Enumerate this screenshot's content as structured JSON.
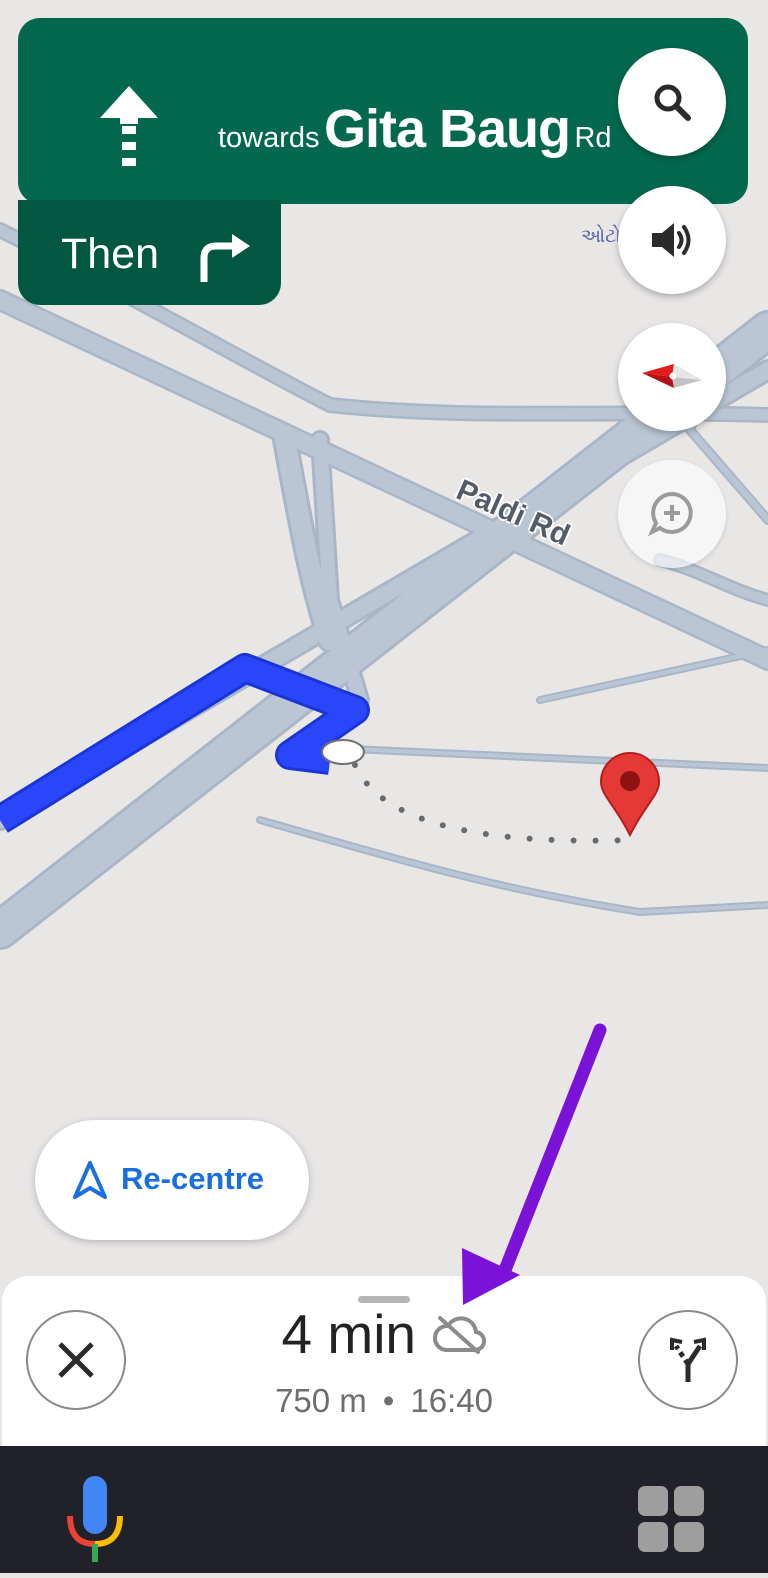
{
  "navigation": {
    "towards": "towards",
    "street": "Gita Baug",
    "street_suffix": "Rd",
    "then_label": "Then",
    "direction_icon": "straight-arrow-icon",
    "next_turn_icon": "turn-right-icon"
  },
  "map": {
    "road_label": "Paldi Rd",
    "place_label_gujarati": "ઓટો"
  },
  "controls": {
    "search_icon": "search-icon",
    "sound_icon": "volume-icon",
    "compass_icon": "compass-icon",
    "report_icon": "add-report-icon"
  },
  "recentre": {
    "label": "Re-centre"
  },
  "trip": {
    "eta": "4 min",
    "distance": "750 m",
    "separator": "•",
    "arrival_time": "16:40",
    "offline_icon": "cloud-off-icon"
  },
  "colors": {
    "banner": "#03684e",
    "then_chip": "#025740",
    "route": "#1f3df5",
    "road": "#b7c4d3",
    "destination_pin": "#e53935",
    "recentre_text": "#1a6fe0",
    "annotation_arrow": "#7a12d8"
  }
}
